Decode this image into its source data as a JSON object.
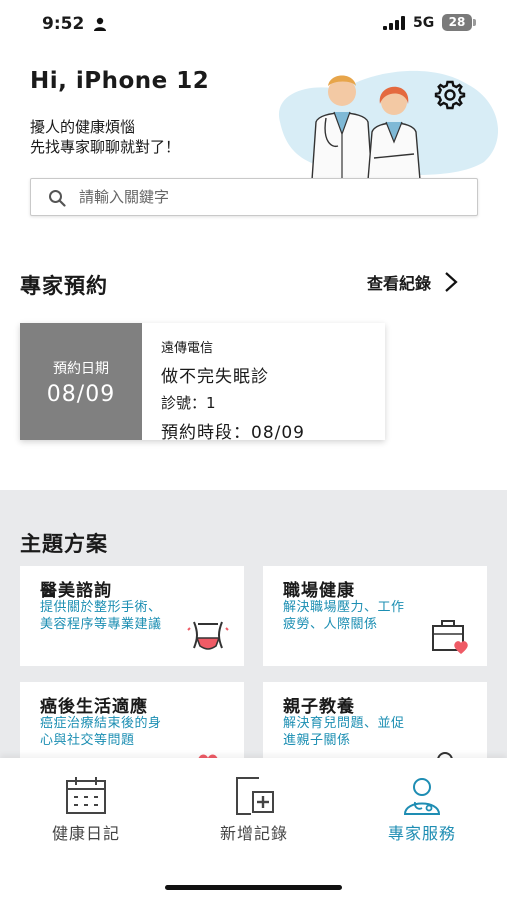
{
  "status_bar": {
    "time": "9:52",
    "network": "5G",
    "battery": "28"
  },
  "header": {
    "greeting": "Hi, iPhone 12",
    "tagline_line1": "擾人的健康煩惱",
    "tagline_line2": "先找專家聊聊就對了！"
  },
  "search": {
    "placeholder": "請輸入關鍵字",
    "value": ""
  },
  "appointments": {
    "title": "專家預約",
    "history_label": "查看紀錄",
    "card": {
      "date_label": "預約日期",
      "date_value": "08/09",
      "provider": "遠傳電信",
      "service": "做不完失眠診",
      "number": "診號：1",
      "time_slot": "預約時段：08/09"
    }
  },
  "themes": {
    "title": "主題方案",
    "items": [
      {
        "title": "醫美諮詢",
        "desc": "提供關於整形手術、美容程序等專業建議",
        "icon": "body-shape-icon"
      },
      {
        "title": "職場健康",
        "desc": "解決職場壓力、工作疲勞、人際關係",
        "icon": "briefcase-heart-icon"
      },
      {
        "title": "癌後生活適應",
        "desc": "癌症治療結束後的身心與社交等問題",
        "icon": "hands-heart-icon"
      },
      {
        "title": "親子教養",
        "desc": "解決育兒問題、並促進親子關係",
        "icon": "parent-child-icon"
      }
    ]
  },
  "bottom_nav": {
    "items": [
      {
        "label": "健康日記",
        "icon": "calendar-icon",
        "active": false
      },
      {
        "label": "新增記錄",
        "icon": "add-record-icon",
        "active": false
      },
      {
        "label": "專家服務",
        "icon": "doctor-icon",
        "active": true
      }
    ]
  },
  "colors": {
    "accent": "#1e8db3",
    "date_block": "#808080",
    "section_bg": "#e9eaec"
  }
}
